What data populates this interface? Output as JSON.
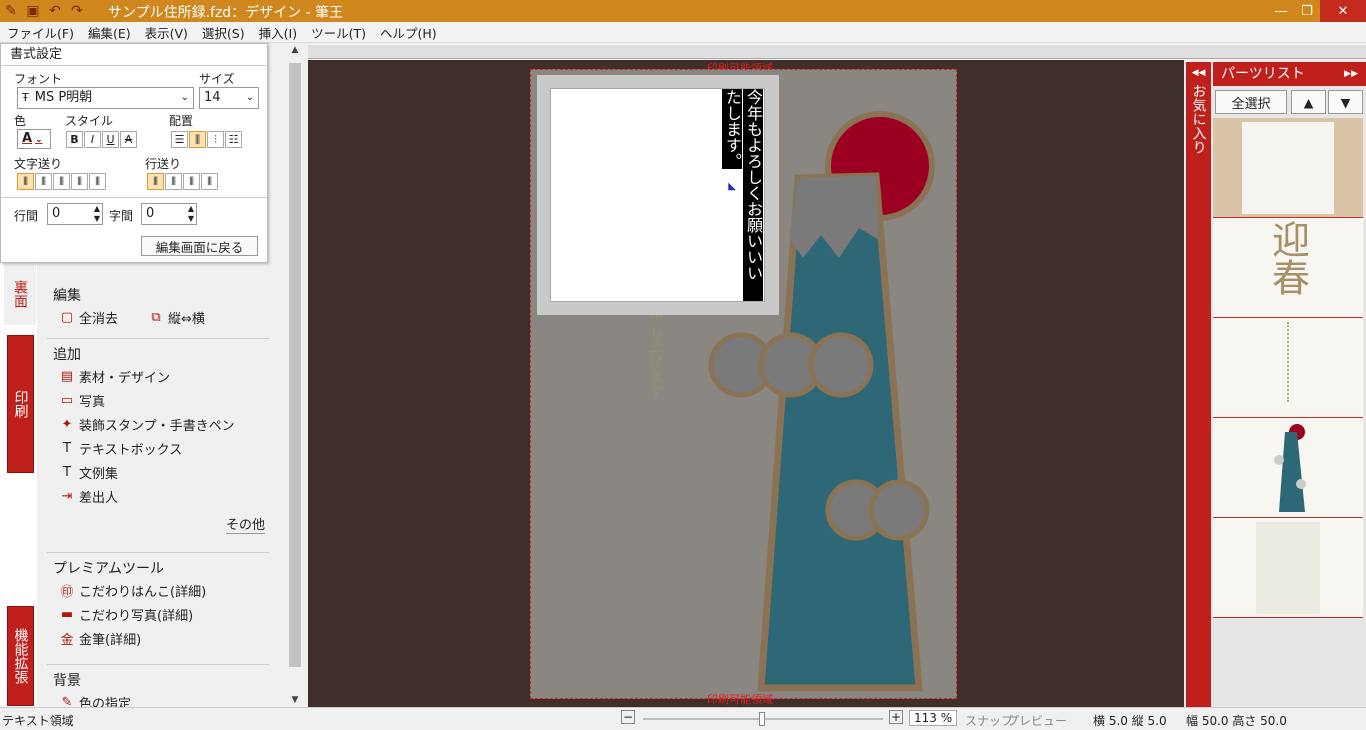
{
  "titlebar": {
    "title": "サンプル住所録.fzd：デザイン - 筆王",
    "min": "—",
    "max": "❐",
    "close": "✕"
  },
  "menu": [
    "ファイル(F)",
    "編集(E)",
    "表示(V)",
    "選択(S)",
    "挿入(I)",
    "ツール(T)",
    "ヘルプ(H)"
  ],
  "sidetabs": {
    "ura": "裏面",
    "insatsu": "印刷",
    "kinou": "機能拡張"
  },
  "format": {
    "title": "書式設定",
    "font_label": "フォント",
    "font_value": "MS P明朝",
    "size_label": "サイズ",
    "size_value": "14",
    "color_label": "色",
    "style_label": "スタイル",
    "align_label": "配置",
    "bold": "B",
    "italic": "I",
    "underline": "U",
    "strike": "A",
    "char_flow_label": "文字送り",
    "line_flow_label": "行送り",
    "line_spacing_label": "行間",
    "line_spacing_value": "0",
    "char_spacing_label": "字間",
    "char_spacing_value": "0",
    "back_button": "編集画面に戻る"
  },
  "edit": {
    "head": "編集",
    "clear": "全消去",
    "swap": "縦⇔横"
  },
  "add": {
    "head": "追加",
    "items": [
      "素材・デザイン",
      "写真",
      "装飾スタンプ・手書きペン",
      "テキストボックス",
      "文例集",
      "差出人"
    ],
    "more": "その他"
  },
  "premium": {
    "head": "プレミアムツール",
    "items": [
      "こだわりはんこ(詳細)",
      "こだわり写真(詳細)",
      "金筆(詳細)"
    ]
  },
  "bg": {
    "head": "背景",
    "item": "色の指定"
  },
  "canvas": {
    "print_area": "印刷可能領域",
    "textbox_col1": "今年もよろしくお願いいい",
    "textbox_col2": "たします。",
    "behind_text": "申し上げます"
  },
  "favorites": "お気に入り",
  "parts": {
    "title": "パーツリスト",
    "select_all": "全選択",
    "up": "▲",
    "down": "▼",
    "geishun": "迎春"
  },
  "status": {
    "left": "テキスト領域",
    "zoom": "113 %",
    "snap": "スナップ",
    "preview": "プレビュー",
    "pos": "横 5.0 縦 5.0",
    "size": "幅 50.0 高さ 50.0"
  },
  "colors": {
    "accent": "#c0201b",
    "title": "#d0871e"
  }
}
